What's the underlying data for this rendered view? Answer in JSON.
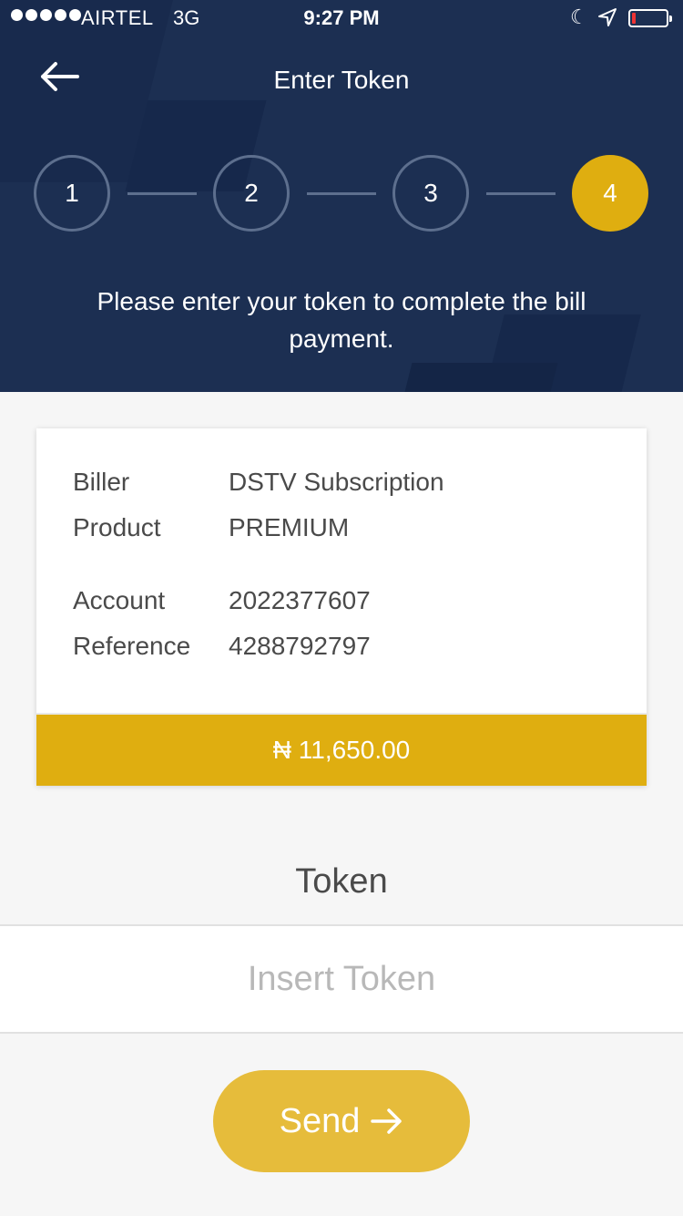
{
  "status_bar": {
    "carrier": "AIRTEL",
    "network": "3G",
    "time": "9:27 PM",
    "battery_level": 0.1
  },
  "nav": {
    "title": "Enter Token",
    "back_icon": "arrow-left-icon"
  },
  "stepper": {
    "steps": [
      "1",
      "2",
      "3",
      "4"
    ],
    "active_step": 4
  },
  "instruction": "Please enter your token to complete the bill payment.",
  "summary": {
    "biller_label": "Biller",
    "biller_value": "DSTV Subscription",
    "product_label": "Product",
    "product_value": "PREMIUM",
    "account_label": "Account",
    "account_value": "2022377607",
    "reference_label": "Reference",
    "reference_value": "4288792797",
    "amount": "₦ 11,650.00"
  },
  "token": {
    "label": "Token",
    "placeholder": "Insert Token",
    "value": ""
  },
  "send_button": {
    "label": "Send",
    "icon": "arrow-right-icon"
  },
  "colors": {
    "header_bg": "#1c2f52",
    "accent": "#dfae10",
    "button": "#e6bc3b",
    "page_bg": "#f6f6f6"
  }
}
